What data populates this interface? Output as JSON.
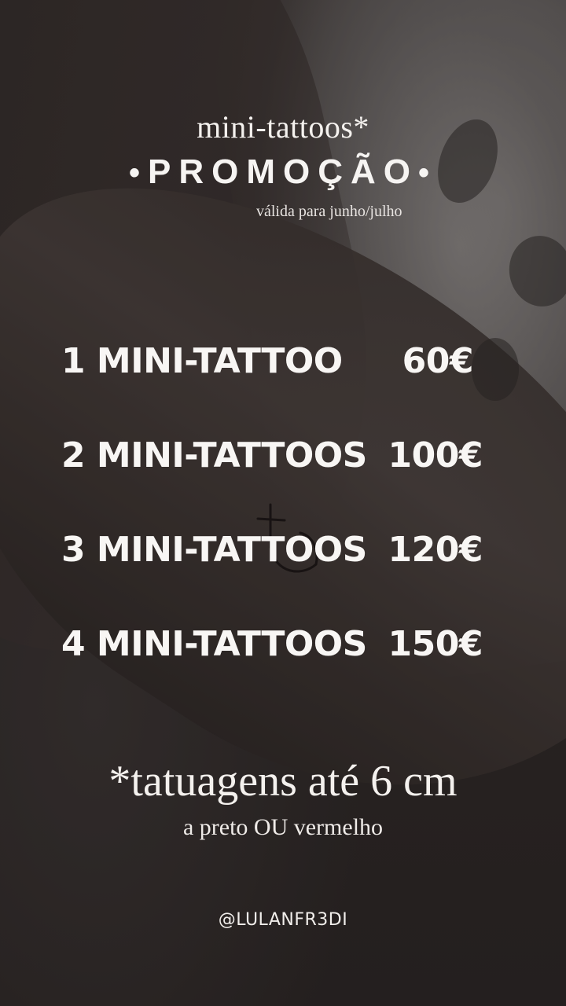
{
  "header": {
    "title": "mini-tattoos*",
    "promo_label": "PROMOÇÃO",
    "validity": "válida para junho/julho"
  },
  "price_list": [
    {
      "item": "1 MINI-TATTOO",
      "price": "60€"
    },
    {
      "item": "2 MINI-TATTOOS",
      "price": "100€"
    },
    {
      "item": "3 MINI-TATTOOS",
      "price": "120€"
    },
    {
      "item": "4 MINI-TATTOOS",
      "price": "150€"
    }
  ],
  "footnote": {
    "main": "*tatuagens até 6 cm",
    "sub": "a preto OU vermelho"
  },
  "handle": "@LULANFR3DI",
  "colors": {
    "text": "#f4f1ee",
    "background": "#2b2726"
  }
}
